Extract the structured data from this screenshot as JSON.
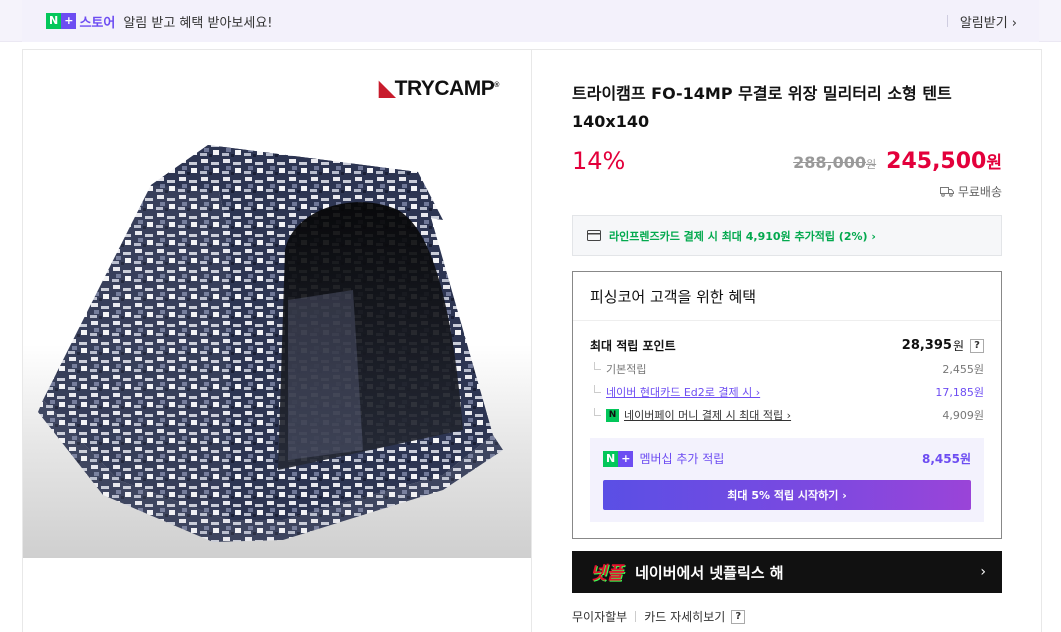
{
  "banner": {
    "n_badge": "N",
    "plus_badge": "+",
    "store_label": "스토어",
    "message": "알림 받고 혜택 받아보세요!",
    "alarm_button": "알림받기 ›"
  },
  "product": {
    "brand_logo": "TRYCAMP",
    "title": "트라이캠프 FO-14MP 무결로 위장 밀리터리 소형 텐트 140x140",
    "discount": "14%",
    "original_price": "288,000",
    "original_won": "원",
    "sale_price": "245,500",
    "sale_won": "원",
    "shipping": "무료배송"
  },
  "card_promo": {
    "text": "라인프렌즈카드 결제 시 최대 4,910원 추가적립 (2%) ›"
  },
  "benefit": {
    "title": "피싱코어 고객을 위한 혜택",
    "max_label": "최대 적립 포인트",
    "max_value": "28,395",
    "max_won": "원",
    "help": "?",
    "items": [
      {
        "label": "기본적립",
        "value": "2,455원"
      },
      {
        "label": "네이버 현대카드 Ed2로 결제 시 ›",
        "value": "17,185원"
      },
      {
        "label": "네이버페이 머니 결제 시 최대 적립 ›",
        "value": "4,909원"
      }
    ],
    "npay_mini": "N",
    "membership": {
      "label": "멤버십 추가 적립",
      "value": "8,455원",
      "button": "최대 5% 적립 시작하기 ›"
    }
  },
  "netflix": {
    "logo": "넷플",
    "text": "네이버에서 넷플릭스 해",
    "arrow": "›"
  },
  "bottom": {
    "installment": "무이자할부",
    "card_detail": "카드 자세히보기",
    "help": "?"
  },
  "colors": {
    "accent_purple": "#6d4df2",
    "sale_red": "#e3003b",
    "naver_green": "#03c75a"
  }
}
